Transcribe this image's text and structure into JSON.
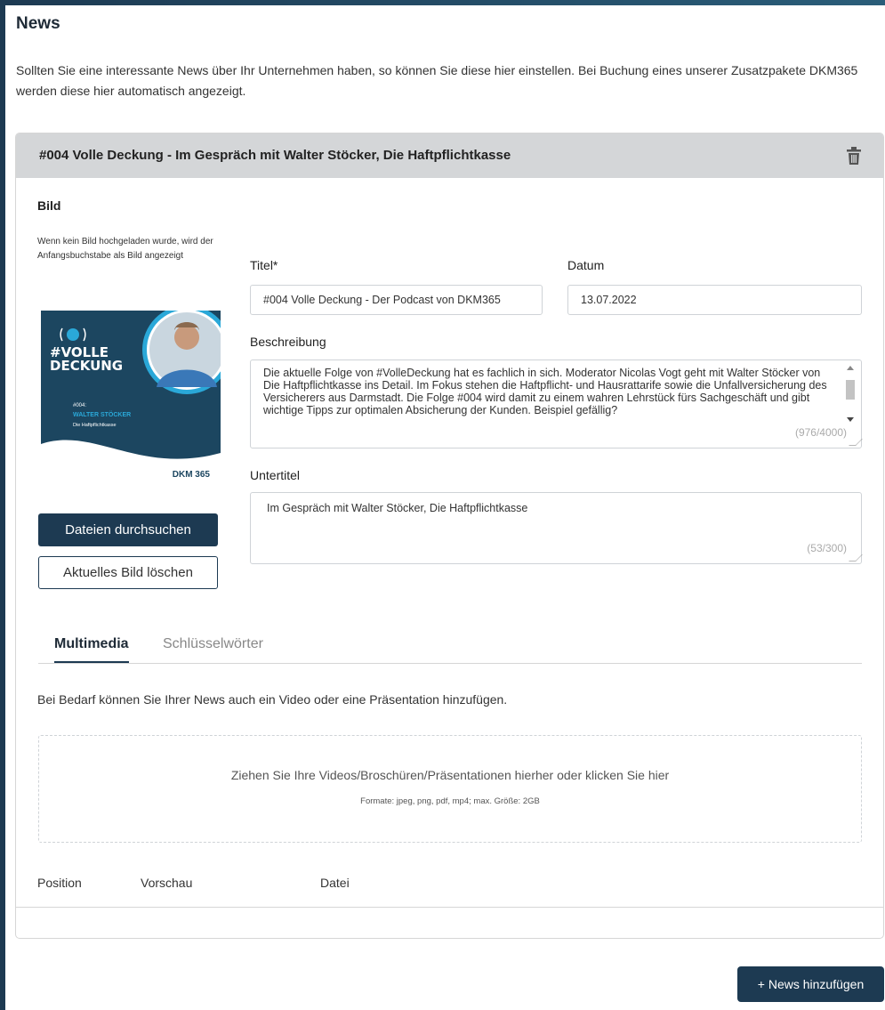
{
  "page": {
    "title": "News",
    "intro": "Sollten Sie eine interessante News über Ihr Unternehmen haben, so können Sie diese hier einstellen. Bei Buchung eines unserer Zusatzpakete DKM365 werden diese hier automatisch angezeigt."
  },
  "news_item": {
    "header_title": "#004 Volle Deckung - Im Gespräch mit Walter Stöcker, Die Haftpflichtkasse",
    "delete_icon": "trash-icon",
    "image": {
      "label": "Bild",
      "hint": "Wenn kein Bild hochgeladen wurde, wird der Anfangsbuchstabe als Bild angezeigt",
      "thumbnail_logo": "#VOLLE DECKUNG",
      "thumbnail_episode": "#004:",
      "thumbnail_name": "WALTER STÖCKER",
      "thumbnail_company": "Die Haftpflichtkasse",
      "thumbnail_brand": "DKM 365",
      "browse_button": "Dateien durchsuchen",
      "delete_button": "Aktuelles Bild löschen"
    },
    "fields": {
      "title_label": "Titel*",
      "title_value": "#004 Volle Deckung - Der Podcast von DKM365",
      "date_label": "Datum",
      "date_value": "13.07.2022",
      "description_label": "Beschreibung",
      "description_value": "Die aktuelle Folge von #VolleDeckung hat es fachlich in sich. Moderator Nicolas Vogt geht mit Walter Stöcker von Die Haftpflichtkasse ins Detail. Im Fokus stehen die Haftpflicht- und Hausrattarife sowie die Unfallversicherung des Versicherers aus Darmstadt. Die Folge #004 wird damit zu einem wahren Lehrstück fürs Sachgeschäft und gibt wichtige Tipps zur optimalen Absicherung der Kunden. Beispiel gefällig?",
      "description_counter": "(976/4000)",
      "subtitle_label": "Untertitel",
      "subtitle_value": "Im Gespräch mit Walter Stöcker, Die Haftpflichtkasse",
      "subtitle_counter": "(53/300)"
    },
    "tabs": [
      {
        "label": "Multimedia",
        "active": true
      },
      {
        "label": "Schlüsselwörter",
        "active": false
      }
    ],
    "multimedia": {
      "hint": "Bei Bedarf können Sie Ihrer News auch ein Video oder eine Präsentation hinzufügen.",
      "dropzone_text": "Ziehen Sie Ihre Videos/Broschüren/Präsentationen hierher oder klicken Sie hier",
      "dropzone_formats": "Formate: jpeg, png, pdf, mp4; max. Größe: 2GB",
      "columns": [
        "Position",
        "Vorschau",
        "Datei"
      ]
    }
  },
  "footer": {
    "add_button": "+ News hinzufügen"
  },
  "colors": {
    "primary": "#1d3a52",
    "header_bg": "#d4d6d8",
    "thumb_bg": "#1c4660",
    "thumb_accent": "#2aa8d8"
  }
}
